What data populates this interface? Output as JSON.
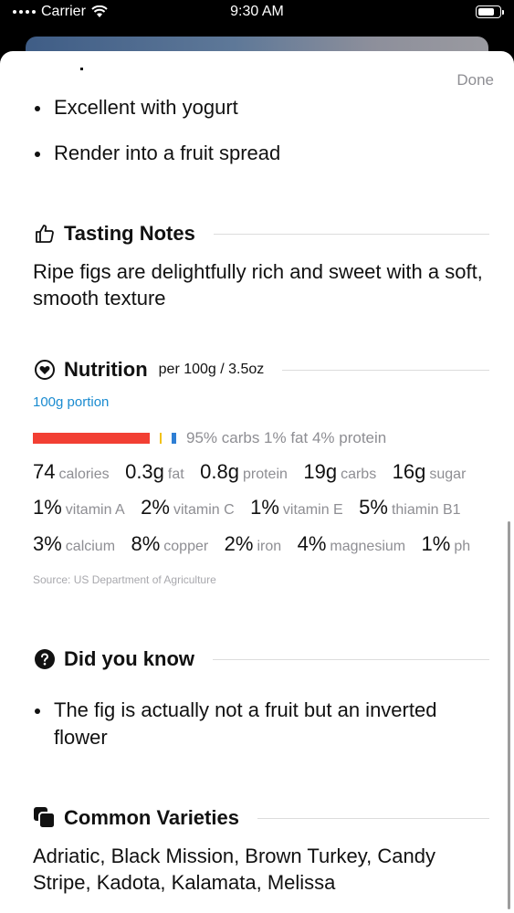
{
  "status_bar": {
    "carrier": "Carrier",
    "time": "9:30 AM"
  },
  "sheet": {
    "done_label": "Done"
  },
  "serving": {
    "items": [
      "Excellent with yogurt",
      "Render into a fruit spread"
    ]
  },
  "tasting_notes": {
    "title": "Tasting Notes",
    "text": "Ripe figs are delightfully rich and sweet with a soft, smooth texture"
  },
  "nutrition": {
    "title": "Nutrition",
    "per": "per 100g / 3.5oz",
    "portion_link": "100g portion",
    "macros": {
      "carbs_pct": 95,
      "fat_pct": 1,
      "protein_pct": 4,
      "text": "95% carbs 1% fat 4% protein",
      "colors": {
        "carbs": "#f23f33",
        "fat": "#f2c218",
        "protein": "#2f7fd4"
      }
    },
    "row1": [
      {
        "value": "74",
        "unit": "calories"
      },
      {
        "value": "0.3g",
        "unit": "fat"
      },
      {
        "value": "0.8g",
        "unit": "protein"
      },
      {
        "value": "19g",
        "unit": "carbs"
      },
      {
        "value": "16g",
        "unit": "sugar"
      }
    ],
    "row2": [
      {
        "value": "1%",
        "unit": "vitamin A"
      },
      {
        "value": "2%",
        "unit": "vitamin C"
      },
      {
        "value": "1%",
        "unit": "vitamin E"
      },
      {
        "value": "5%",
        "unit": "thiamin B1"
      }
    ],
    "row3": [
      {
        "value": "3%",
        "unit": "calcium"
      },
      {
        "value": "8%",
        "unit": "copper"
      },
      {
        "value": "2%",
        "unit": "iron"
      },
      {
        "value": "4%",
        "unit": "magnesium"
      },
      {
        "value": "1%",
        "unit": "ph"
      }
    ],
    "source": "Source: US Department of Agriculture"
  },
  "did_you_know": {
    "title": "Did you know",
    "items": [
      "The fig is actually not a fruit but an inverted flower"
    ]
  },
  "varieties": {
    "title": "Common Varieties",
    "text": "Adriatic, Black Mission, Brown Turkey, Candy Stripe, Kadota, Kalamata, Melissa"
  },
  "icons": {
    "tasting": "thumbs-up-icon",
    "nutrition": "heart-icon",
    "did_you_know": "question-icon",
    "varieties": "stacked-squares-icon"
  }
}
